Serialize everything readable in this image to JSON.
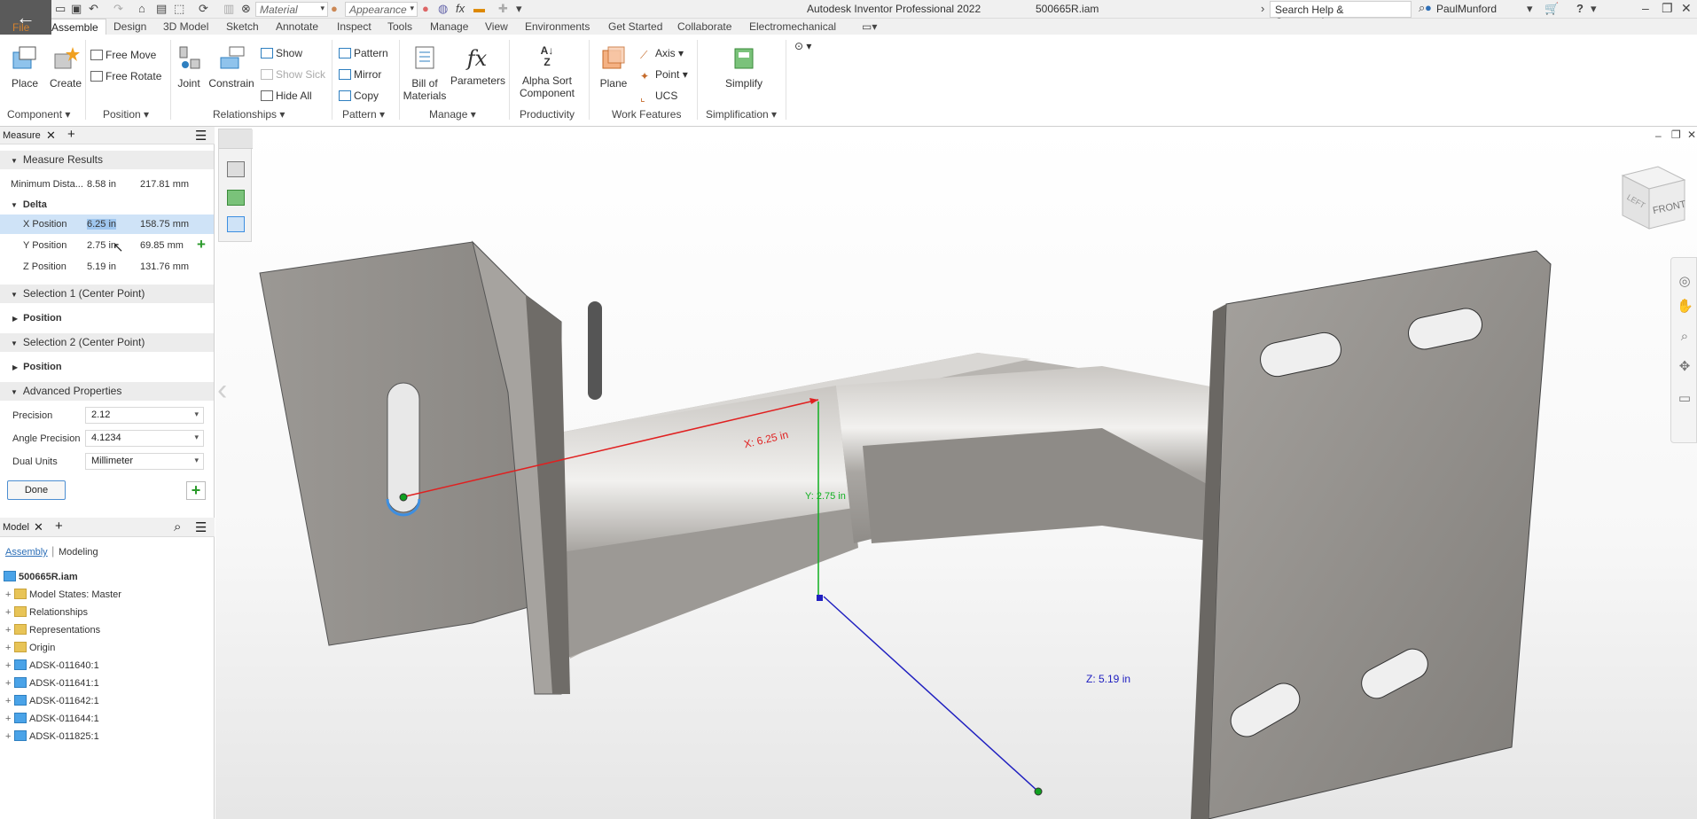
{
  "titlebar": {
    "back_arrow": "←",
    "material_combo": "Material",
    "appearance_combo": "Appearance",
    "fx_label": "fx",
    "app_title": "Autodesk Inventor Professional 2022",
    "doc_name": "500665R.iam",
    "search_placeholder": "Search Help & Commands...",
    "user_name": "PaulMunford",
    "help_label": "?"
  },
  "tabs": [
    "File",
    "Assemble",
    "Design",
    "3D Model",
    "Sketch",
    "Annotate",
    "Inspect",
    "Tools",
    "Manage",
    "View",
    "Environments",
    "Get Started",
    "Collaborate",
    "Electromechanical"
  ],
  "ribbon": {
    "place": "Place",
    "create": "Create",
    "free_move": "Free Move",
    "free_rotate": "Free Rotate",
    "joint": "Joint",
    "constrain": "Constrain",
    "show": "Show",
    "show_sick": "Show Sick",
    "hide_all": "Hide All",
    "pattern": "Pattern",
    "mirror": "Mirror",
    "copy": "Copy",
    "bill_of_materials_1": "Bill of",
    "bill_of_materials_2": "Materials",
    "parameters": "Parameters",
    "alpha_sort_1": "Alpha Sort",
    "alpha_sort_2": "Component",
    "plane": "Plane",
    "axis": "Axis",
    "point": "Point",
    "ucs": "UCS",
    "simplify": "Simplify",
    "groups": {
      "component": "Component",
      "position": "Position",
      "relationships": "Relationships",
      "pattern": "Pattern",
      "manage": "Manage",
      "productivity": "Productivity",
      "work_features": "Work Features",
      "simplification": "Simplification"
    }
  },
  "measure": {
    "panel_title": "Measure",
    "results_title": "Measure Results",
    "min_dist_label": "Minimum Dista...",
    "min_dist_in": "8.58 in",
    "min_dist_mm": "217.81 mm",
    "delta_title": "Delta",
    "x_label": "X Position",
    "x_in": "6.25 in",
    "x_mm": "158.75 mm",
    "y_label": "Y Position",
    "y_in": "2.75 in",
    "y_mm": "69.85 mm",
    "z_label": "Z Position",
    "z_in": "5.19 in",
    "z_mm": "131.76 mm",
    "sel1_title": "Selection 1 (Center Point)",
    "sel1_position": "Position",
    "sel2_title": "Selection 2 (Center Point)",
    "sel2_position": "Position",
    "adv_title": "Advanced Properties",
    "precision_label": "Precision",
    "precision_value": "2.12",
    "angle_precision_label": "Angle Precision",
    "angle_precision_value": "4.1234",
    "dual_units_label": "Dual Units",
    "dual_units_value": "Millimeter",
    "done_label": "Done"
  },
  "model": {
    "panel_title": "Model",
    "tab_assembly": "Assembly",
    "tab_modeling": "Modeling",
    "root": "500665R.iam",
    "items": [
      "Model States: Master",
      "Relationships",
      "Representations",
      "Origin",
      "ADSK-011640:1",
      "ADSK-011641:1",
      "ADSK-011642:1",
      "ADSK-011644:1",
      "ADSK-011825:1"
    ]
  },
  "viewport": {
    "x_dim": "X: 6.25 in",
    "y_dim": "Y: 2.75 in",
    "z_dim": "Z: 5.19 in",
    "viewcube_front": "FRONT",
    "viewcube_left": "LEFT"
  },
  "colors": {
    "file_tab": "#d4822f",
    "x_axis": "#e02020",
    "y_axis": "#10b020",
    "z_axis": "#2020c0",
    "highlight": "#cfe3f7"
  }
}
